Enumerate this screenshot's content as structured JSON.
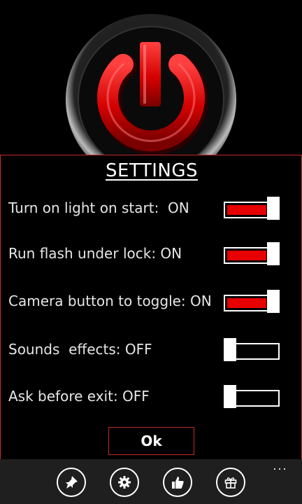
{
  "settings": {
    "title": "SETTINGS",
    "items": [
      {
        "label": "Turn on light on start:  ON",
        "on": true
      },
      {
        "label": "Run flash under lock: ON",
        "on": true
      },
      {
        "label": "Camera button to toggle: ON",
        "on": true
      },
      {
        "label": "Sounds  effects: OFF",
        "on": false
      },
      {
        "label": "Ask before exit: OFF",
        "on": false
      }
    ],
    "ok_label": "Ok"
  },
  "appbar": {
    "buttons": [
      {
        "icon": "pin-icon"
      },
      {
        "icon": "settings-gear-icon"
      },
      {
        "icon": "thumbs-up-icon"
      },
      {
        "icon": "gift-icon"
      }
    ],
    "more_label": "..."
  },
  "colors": {
    "accent_red": "#e60000",
    "panel_border": "#c62828",
    "appbar_bg": "#1f1f1f"
  }
}
